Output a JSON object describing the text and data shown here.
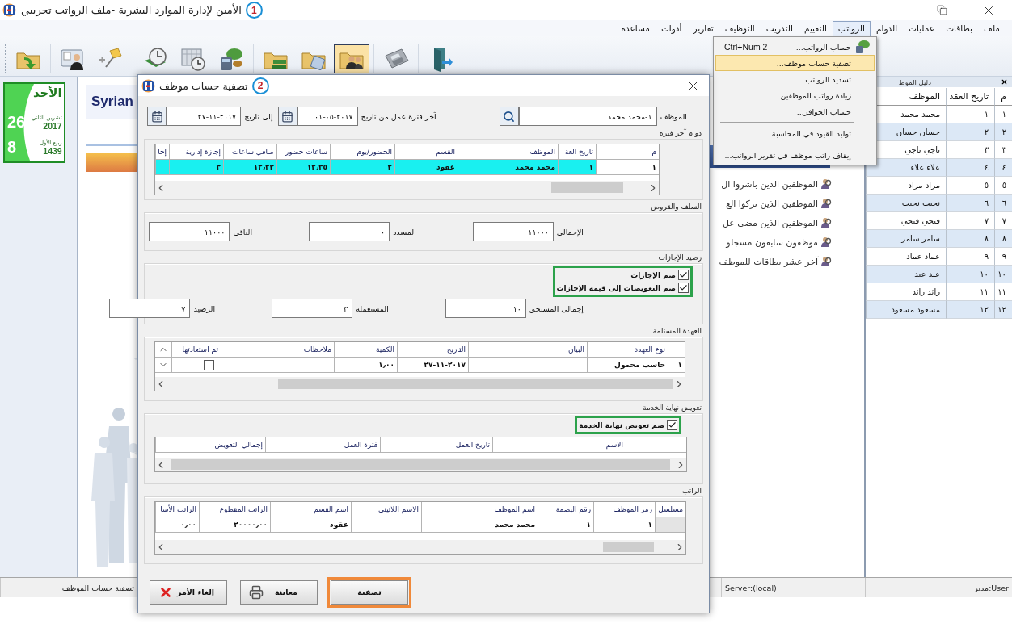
{
  "window": {
    "title": "الأمين لإدارة الموارد البشرية -ملف الرواتب تجريبي",
    "step": "1"
  },
  "menu": [
    {
      "label": "ملف",
      "selected": false
    },
    {
      "label": "بطاقات",
      "selected": false
    },
    {
      "label": "عمليات",
      "selected": false
    },
    {
      "label": "الدوام",
      "selected": false
    },
    {
      "label": "الرواتب",
      "selected": true
    },
    {
      "label": "التقييم",
      "selected": false
    },
    {
      "label": "التدريب",
      "selected": false
    },
    {
      "label": "التوظيف",
      "selected": false
    },
    {
      "label": "تقارير",
      "selected": false
    },
    {
      "label": "أدوات",
      "selected": false
    },
    {
      "label": "مساعدة",
      "selected": false
    }
  ],
  "salary_menu": {
    "items": [
      {
        "kind": "item",
        "label": "حساب الرواتب...",
        "shortcut": "Ctrl+Num 2",
        "has_icon": true,
        "selected": false
      },
      {
        "kind": "item",
        "label": "تصفية حساب موظف...",
        "selected": true
      },
      {
        "kind": "item",
        "label": "تسديد الرواتب...",
        "selected": false
      },
      {
        "kind": "item",
        "label": "زيادة رواتب الموظفين...",
        "selected": false
      },
      {
        "kind": "item",
        "label": "حساب الحوافز...",
        "selected": false
      },
      {
        "kind": "separator"
      },
      {
        "kind": "item",
        "label": "توليد القيود في المحاسبة ...",
        "selected": false
      },
      {
        "kind": "separator"
      },
      {
        "kind": "item",
        "label": "إيقاف راتب موظف في تقرير الرواتب...",
        "selected": false
      }
    ]
  },
  "toolbar": [
    [
      {
        "kind": "folder-arrow",
        "selected": false
      }
    ],
    [
      {
        "kind": "person-card",
        "selected": false
      },
      {
        "kind": "pin",
        "selected": false
      }
    ],
    [
      {
        "kind": "clock",
        "selected": false
      },
      {
        "kind": "calendar-clock",
        "selected": false
      },
      {
        "kind": "money",
        "selected": false
      }
    ],
    [
      {
        "kind": "folder-books",
        "selected": false
      },
      {
        "kind": "folder-tag",
        "selected": false
      },
      {
        "kind": "folder-people",
        "selected": true
      }
    ],
    [
      {
        "kind": "calculator",
        "selected": false
      }
    ],
    [
      {
        "kind": "door",
        "selected": false
      }
    ]
  ],
  "calendar": {
    "weekday": "الأحد",
    "day": "26",
    "month": "تشرين الثاني",
    "year": "2017",
    "hijri_day": "8",
    "hijri_month": "ربيع الأول",
    "hijri_year": "1439"
  },
  "banner": {
    "text": "Syrian"
  },
  "reports": [
    "الموظفين الذين باشروا ال",
    "الموظفين الذين تركوا الع",
    "الموظفين الذين مضى عل",
    "موظفون سابقون مسجلو",
    "آخر عشر بطاقات للموظف"
  ],
  "employee_directory": {
    "title": "دليل الموظ",
    "columns": [
      "م",
      "تاريخ العقد",
      "الموظف"
    ],
    "rows": [
      [
        "١",
        "١",
        "محمد محمد"
      ],
      [
        "٢",
        "٢",
        "حسان حسان"
      ],
      [
        "٣",
        "٣",
        "ناجي ناجي"
      ],
      [
        "٤",
        "٤",
        "علاء علاء"
      ],
      [
        "٥",
        "٥",
        "مراد مراد"
      ],
      [
        "٦",
        "٦",
        "نجيب نجيب"
      ],
      [
        "٧",
        "٧",
        "فتحي فتحي"
      ],
      [
        "٨",
        "٨",
        "سامر سامر"
      ],
      [
        "٩",
        "٩",
        "عماد عماد"
      ],
      [
        "١٠",
        "١٠",
        "عبد عبد"
      ],
      [
        "١١",
        "١١",
        "رائد رائد"
      ],
      [
        "١٢",
        "١٢",
        "مسعود مسعود"
      ]
    ]
  },
  "status_bar": [
    "User:مدير",
    "Server:(local)",
    "تصفية حساب الموظف"
  ],
  "dialog": {
    "title": "تصفية حساب موظف",
    "step": "2",
    "employee": {
      "label": "الموظف",
      "value": "١-محمد محمد"
    },
    "from_date": {
      "label": "آخر فترة عمل من تاريخ",
      "value": "٠١-٠٥-٢٠١٧"
    },
    "to_date": {
      "label": "إلى تاريخ",
      "value": "٢٧-١١-٢٠١٧"
    },
    "attendance": {
      "title": "دوام آخر فترة",
      "columns": [
        "م",
        "تاريخ العة",
        "الموظف",
        "القسم",
        "الحضور/يوم",
        "ساعات حضور",
        "صافي ساعات",
        "إجازة إدارية",
        "إجا"
      ],
      "rows": [
        {
          "selected": true,
          "cells": [
            "١",
            "١",
            "محمد محمد",
            "عقود",
            "٢",
            "١٢٫٣٥",
            "١٢٫٢٣",
            "٣",
            null
          ]
        }
      ]
    },
    "loans": {
      "title": "السلف والقروض",
      "fields": [
        {
          "label": "الإجمالي",
          "value": "١١٠٠٠"
        },
        {
          "label": "المسدد",
          "value": "٠"
        },
        {
          "label": "الباقي",
          "value": "١١٠٠٠"
        }
      ]
    },
    "leaves": {
      "title": "رصيد الإجازات",
      "highlighted": true,
      "options": [
        {
          "label": "ضم الإجازات",
          "checked": true
        },
        {
          "label": "ضم التعويضات إلى قيمة الإجازات",
          "checked": true
        }
      ],
      "fields": [
        {
          "label": "إجمالي المستحق",
          "value": "١٠"
        },
        {
          "label": "المستعملة",
          "value": "٣"
        },
        {
          "label": "الرصيد",
          "value": "٧"
        }
      ]
    },
    "custody": {
      "title": "العهدة المستلمة",
      "columns": [
        "نوع العهدة",
        "البيان",
        "التاريخ",
        "الكمية",
        "ملاحظات",
        "تم استعادتها"
      ],
      "rows": [
        {
          "marker": "١",
          "cells": [
            "حاسب محمول",
            null,
            "٢٧-١١-٢٠١٧",
            "١٫٠٠",
            null,
            false
          ]
        }
      ]
    },
    "end_of_service": {
      "title": "تعويض نهاية الخدمة",
      "highlighted": true,
      "options": [
        {
          "label": "ضم تعويض نهاية الخدمة",
          "checked": true
        }
      ],
      "columns": [
        "الاسم",
        "تاريخ العمل",
        "فترة العمل",
        "إجمالي التعويض"
      ]
    },
    "salary": {
      "title": "الراتب",
      "columns": [
        "مسلسل",
        "رمز الموظف",
        "رقم البصمة",
        "اسم الموظف",
        "الاسم اللاتيني",
        "اسم القسم",
        "الراتب المقطوع",
        "الراتب الأسا"
      ],
      "rows": [
        {
          "cells": [
            null,
            "١",
            "١",
            "محمد محمد",
            null,
            "عقود",
            "٢٠٠٠٠٫٠٠",
            "٠٫٠٠"
          ]
        }
      ]
    },
    "buttons": [
      {
        "kind": "settle",
        "label": "تصفية",
        "highlighted": true
      },
      {
        "kind": "preview",
        "label": "معاينة",
        "highlighted": false
      },
      {
        "kind": "cancel",
        "label": "إلغاء الأمر",
        "highlighted": false
      }
    ]
  }
}
